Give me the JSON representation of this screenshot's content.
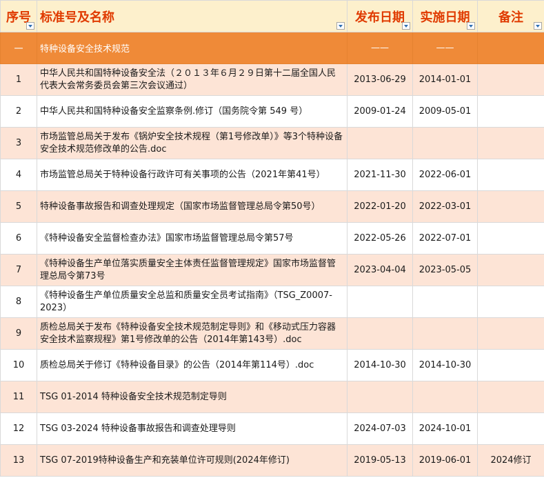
{
  "headers": {
    "no": "序号",
    "name": "标准号及名称",
    "pub": "发布日期",
    "impl": "实施日期",
    "note": "备注"
  },
  "section": {
    "no": "一",
    "name": "特种设备安全技术规范",
    "pub": "——",
    "impl": "——"
  },
  "rows": [
    {
      "no": "1",
      "name": "中华人民共和国特种设备安全法（２０１３年６月２９日第十二届全国人民代表大会常务委员会第三次会议通过）",
      "pub": "2013-06-29",
      "impl": "2014-01-01",
      "note": ""
    },
    {
      "no": "2",
      "name": "中华人民共和国特种设备安全监察条例.修订（国务院令第 549 号）",
      "pub": "2009-01-24",
      "impl": "2009-05-01",
      "note": ""
    },
    {
      "no": "3",
      "name": "市场监管总局关于发布《锅炉安全技术规程（第1号修改单）》等3个特种设备安全技术规范修改单的公告.doc",
      "pub": "",
      "impl": "",
      "note": ""
    },
    {
      "no": "4",
      "name": "市场监管总局关于特种设备行政许可有关事项的公告（2021年第41号）",
      "pub": "2021-11-30",
      "impl": "2022-06-01",
      "note": ""
    },
    {
      "no": "5",
      "name": "特种设备事故报告和调查处理规定（国家市场监督管理总局令第50号）",
      "pub": "2022-01-20",
      "impl": "2022-03-01",
      "note": ""
    },
    {
      "no": "6",
      "name": "《特种设备安全监督检查办法》国家市场监督管理总局令第57号",
      "pub": "2022-05-26",
      "impl": "2022-07-01",
      "note": ""
    },
    {
      "no": "7",
      "name": "《特种设备生产单位落实质量安全主体责任监督管理规定》国家市场监督管理总局令第73号",
      "pub": "2023-04-04",
      "impl": "2023-05-05",
      "note": ""
    },
    {
      "no": "8",
      "name": "《特种设备生产单位质量安全总监和质量安全员考试指南》（TSG_Z0007-2023）",
      "pub": "",
      "impl": "",
      "note": ""
    },
    {
      "no": "9",
      "name": "质检总局关于发布《特种设备安全技术规范制定导则》和《移动式压力容器安全技术监察规程》第1号修改单的公告（2014年第143号）.doc",
      "pub": "",
      "impl": "",
      "note": ""
    },
    {
      "no": "10",
      "name": "质检总局关于修订《特种设备目录》的公告（2014年第114号）.doc",
      "pub": "2014-10-30",
      "impl": "2014-10-30",
      "note": ""
    },
    {
      "no": "11",
      "name": "TSG 01-2014 特种设备安全技术规范制定导则",
      "pub": "",
      "impl": "",
      "note": ""
    },
    {
      "no": "12",
      "name": "TSG 03-2024 特种设备事故报告和调查处理导则",
      "pub": "2024-07-03",
      "impl": "2024-10-01",
      "note": ""
    },
    {
      "no": "13",
      "name": "TSG 07-2019特种设备生产和充装单位许可规则(2024年修订)",
      "pub": "2019-05-13",
      "impl": "2019-06-01",
      "note": "2024修订"
    }
  ]
}
